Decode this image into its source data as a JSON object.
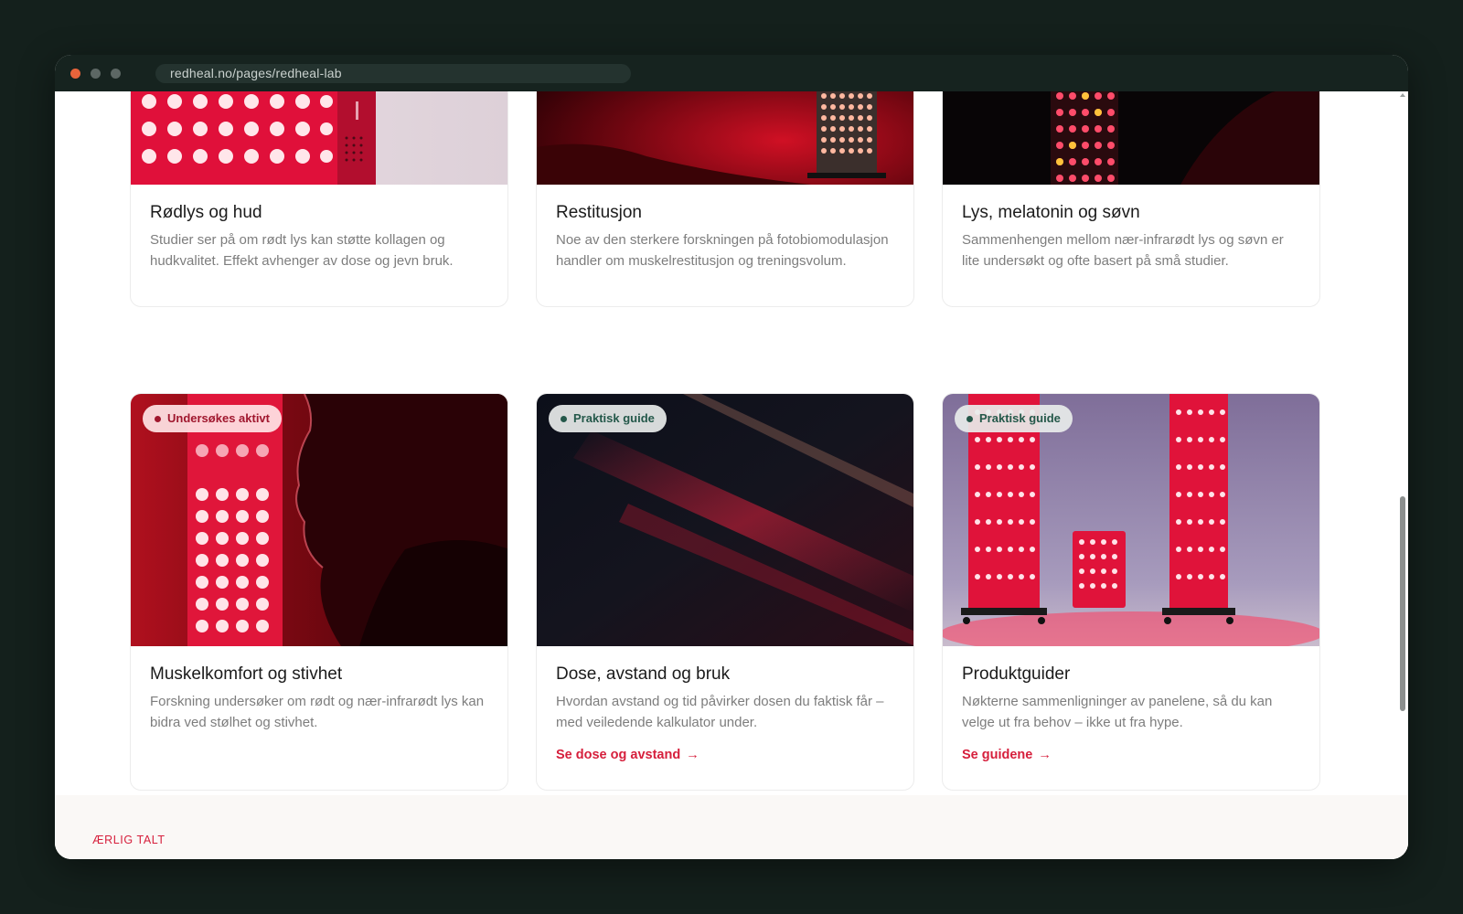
{
  "browser": {
    "url": "redheal.no/pages/redheal-lab"
  },
  "cards_top": [
    {
      "title": "Rødlys og hud",
      "text": "Studier ser på om rødt lys kan støtte kollagen og hudkvalitet. Effekt avhenger av dose og jevn bruk."
    },
    {
      "title": "Restitusjon",
      "text": "Noe av den sterkere forskningen på fotobiomodulasjon handler om muskelrestitusjon og treningsvolum."
    },
    {
      "title": "Lys, melatonin og søvn",
      "text": "Sammenhengen mellom nær-infrarødt lys og søvn er lite undersøkt og ofte basert på små studier."
    }
  ],
  "cards_bottom": [
    {
      "badge": "Undersøkes aktivt",
      "title": "Muskelkomfort og stivhet",
      "text": "Forskning undersøker om rødt og nær-infrarødt lys kan bidra ved stølhet og stivhet."
    },
    {
      "badge": "Praktisk guide",
      "title": "Dose, avstand og bruk",
      "text": "Hvordan avstand og tid påvirker dosen du faktisk får – med veiledende kalkulator under.",
      "link": "Se dose og avstand"
    },
    {
      "badge": "Praktisk guide",
      "title": "Produktguider",
      "text": "Nøkterne sammenligninger av panelene, så du kan velge ut fra behov – ikke ut fra hype.",
      "link": "Se guidene"
    }
  ],
  "next_section": {
    "eyebrow": "ÆRLIG TALT"
  },
  "colors": {
    "accent": "#d61f3c",
    "dark": "#14201c",
    "badge_green": "#24584a",
    "badge_red": "#a0172e"
  },
  "icons": {
    "link_arrow": "arrow-right-icon"
  }
}
